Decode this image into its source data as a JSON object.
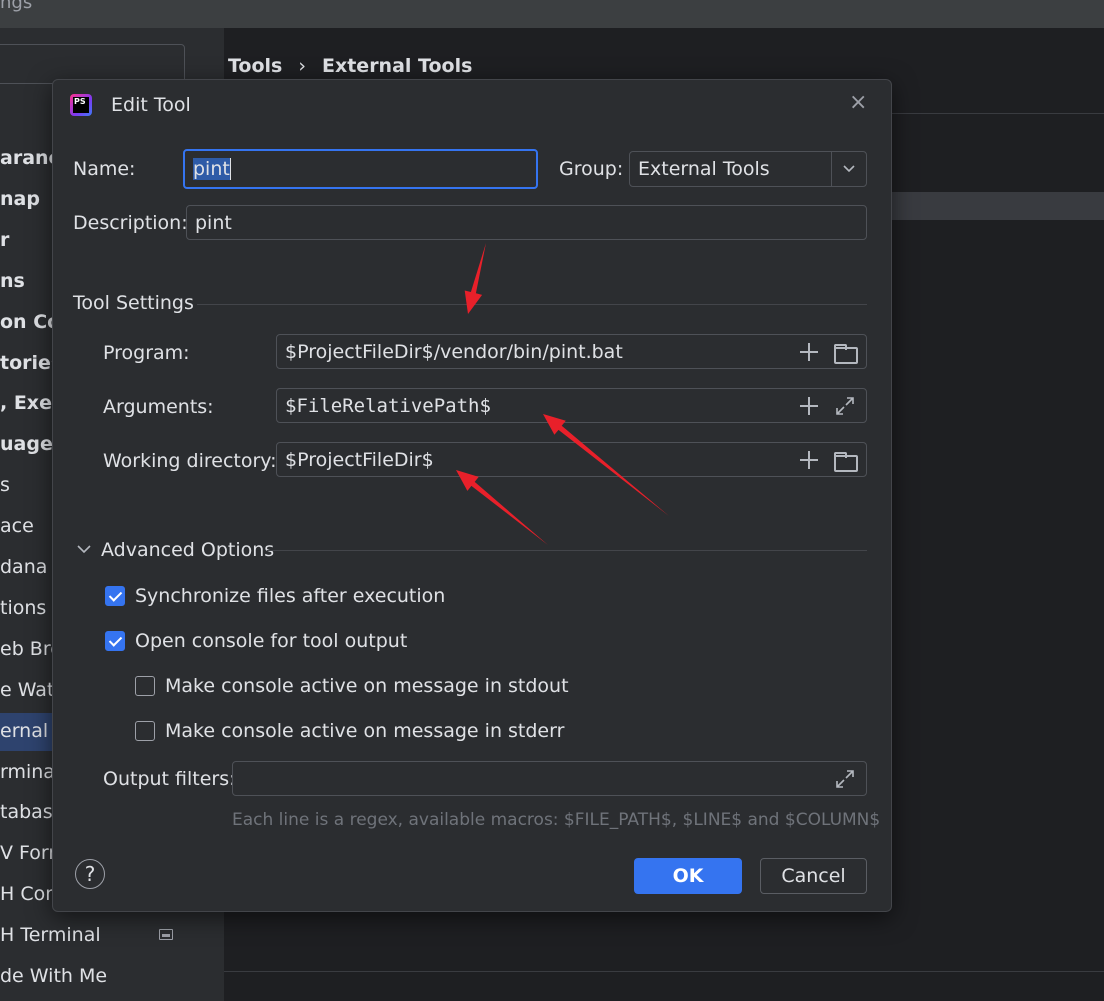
{
  "background": {
    "window_title": "ngs",
    "breadcrumb": {
      "parent": "Tools",
      "separator": "›",
      "current": "External Tools"
    },
    "sidebar_items": [
      {
        "label": "aranc",
        "bold": true
      },
      {
        "label": "nap",
        "bold": true
      },
      {
        "label": "r",
        "bold": true
      },
      {
        "label": "ns",
        "bold": true
      },
      {
        "label": "on Co",
        "bold": true
      },
      {
        "label": "tories",
        "bold": true
      },
      {
        "label": ", Exec",
        "bold": true
      },
      {
        "label": "uages",
        "bold": true
      },
      {
        "label": "s",
        "bold": false
      },
      {
        "label": "ace",
        "bold": false
      },
      {
        "label": "dana",
        "bold": false
      },
      {
        "label": "tions o",
        "bold": false
      },
      {
        "label": "eb Bro",
        "bold": false
      },
      {
        "label": "e Watc",
        "bold": false
      },
      {
        "label": "ernal T",
        "bold": false
      },
      {
        "label": "rminal",
        "bold": false
      },
      {
        "label": "tabase",
        "bold": false
      },
      {
        "label": "V Form",
        "bold": false
      },
      {
        "label": "H Con",
        "bold": false
      },
      {
        "label": "H Terminal",
        "bold": false
      },
      {
        "label": "de With Me",
        "bold": false
      }
    ]
  },
  "dialog": {
    "title": "Edit Tool",
    "app_icon_text": "PS",
    "close_glyph": "×",
    "name_label": "Name:",
    "name_value": "pint",
    "group_label": "Group:",
    "group_value": "External Tools",
    "description_label": "Description:",
    "description_value": "pint",
    "tool_settings": {
      "header": "Tool Settings",
      "program_label": "Program:",
      "program_value": "$ProjectFileDir$/vendor/bin/pint.bat",
      "arguments_label": "Arguments:",
      "arguments_value": "$FileRelativePath$",
      "working_dir_label": "Working directory:",
      "working_dir_value": "$ProjectFileDir$"
    },
    "advanced": {
      "header": "Advanced Options",
      "options": [
        {
          "label": "Synchronize files after execution",
          "checked": true
        },
        {
          "label": "Open console for tool output",
          "checked": true
        },
        {
          "label": "Make console active on message in stdout",
          "checked": false
        },
        {
          "label": "Make console active on message in stderr",
          "checked": false
        }
      ],
      "output_filters_label": "Output filters:",
      "output_filters_value": "",
      "output_filters_hint": "Each line is a regex, available macros: $FILE_PATH$, $LINE$ and $COLUMN$"
    },
    "help_glyph": "?",
    "ok_label": "OK",
    "cancel_label": "Cancel"
  },
  "colors": {
    "accent": "#3574f0",
    "annotation_arrow": "#e8202a",
    "dialog_bg": "#2b2d30"
  }
}
